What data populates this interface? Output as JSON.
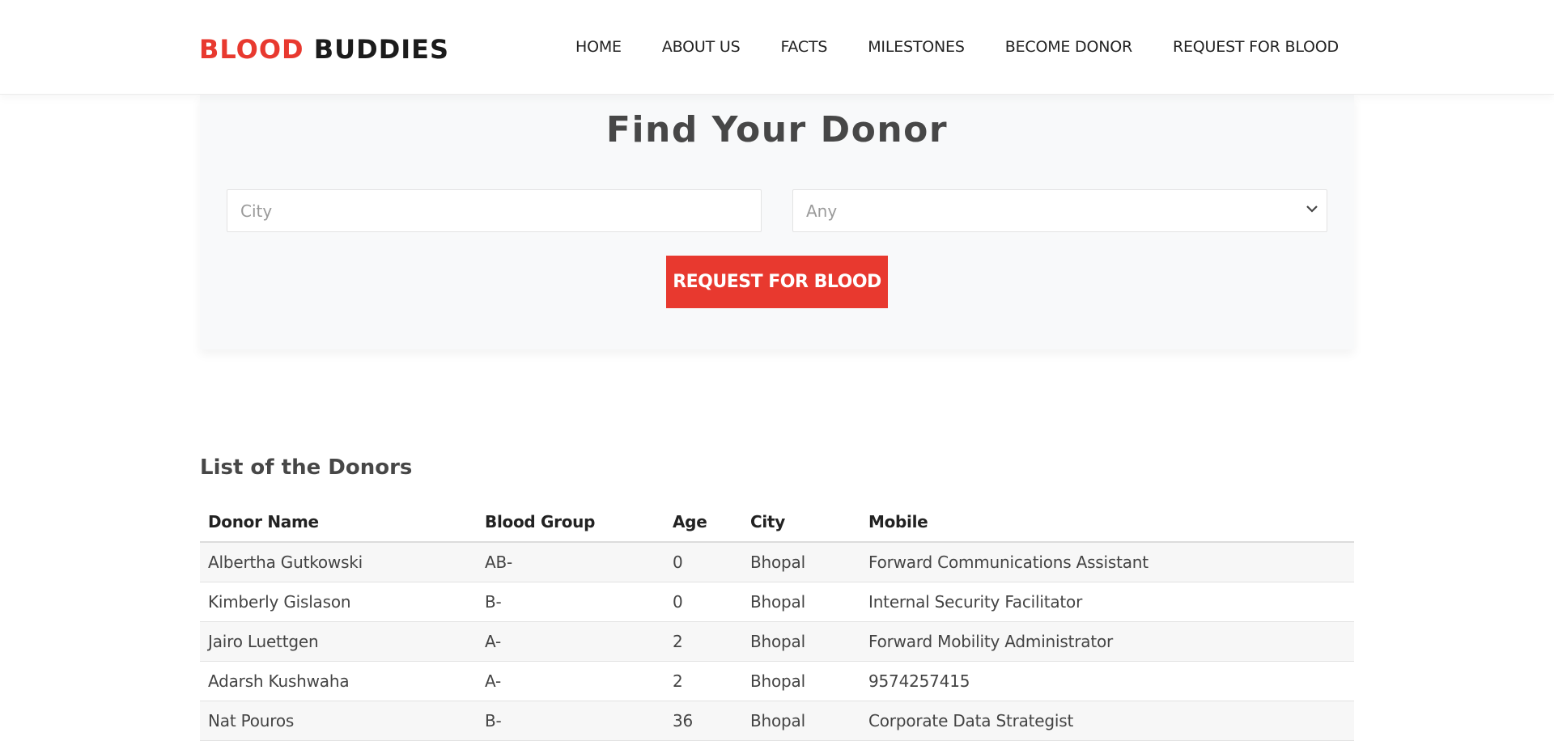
{
  "brand": {
    "part1": "BLOOD",
    "part2": "BUDDIES",
    "accent_color": "#e8392f"
  },
  "nav": {
    "items": [
      {
        "label": "HOME"
      },
      {
        "label": "ABOUT US"
      },
      {
        "label": "FACTS"
      },
      {
        "label": "MILESTONES"
      },
      {
        "label": "BECOME DONOR"
      },
      {
        "label": "REQUEST FOR BLOOD"
      }
    ]
  },
  "finder": {
    "title": "Find Your Donor",
    "city_placeholder": "City",
    "blood_group_selected": "Any",
    "dropdown_icon": "chevron-down-icon",
    "button_label": "REQUEST FOR BLOOD"
  },
  "donors": {
    "title": "List of the Donors",
    "columns": [
      "Donor Name",
      "Blood Group",
      "Age",
      "City",
      "Mobile"
    ],
    "rows": [
      [
        "Albertha Gutkowski",
        "AB-",
        "0",
        "Bhopal",
        "Forward Communications Assistant"
      ],
      [
        "Kimberly Gislason",
        "B-",
        "0",
        "Bhopal",
        "Internal Security Facilitator"
      ],
      [
        "Jairo Luettgen",
        "A-",
        "2",
        "Bhopal",
        "Forward Mobility Administrator"
      ],
      [
        "Adarsh Kushwaha",
        "A-",
        "2",
        "Bhopal",
        "9574257415"
      ],
      [
        "Nat Pouros",
        "B-",
        "36",
        "Bhopal",
        "Corporate Data Strategist"
      ]
    ]
  }
}
